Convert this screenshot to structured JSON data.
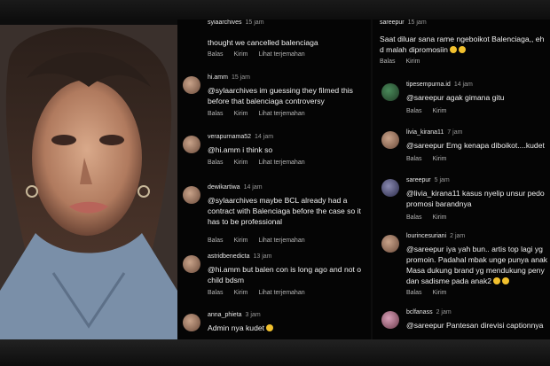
{
  "photo": {
    "label": ""
  },
  "actions": {
    "reply": "Balas",
    "send": "Kirim",
    "translate": "Lihat terjemahan"
  },
  "mid": {
    "top_user": "syiaarchives",
    "top_time": "15 jam",
    "top_text": "thought we cancelled balenciaga",
    "comments": [
      {
        "user": "hi.amm",
        "time": "15 jam",
        "text": "@sylaarchives im guessing they filmed this before that balenciaga controversy"
      },
      {
        "user": "verapurnama52",
        "time": "14 jam",
        "text": "@hi.amm i think so"
      },
      {
        "user": "dewikartiwa",
        "time": "14 jam",
        "text": "@sylaarchives maybe BCL already had a contract with Balenciaga before the case so it has to be professional"
      },
      {
        "user": "astridbenedicta",
        "time": "13 jam",
        "text": "@hi.amm but balen con is long ago and not o child bdsm"
      },
      {
        "user": "anna_phieta",
        "time": "3 jam",
        "text": "Admin nya kudet"
      }
    ]
  },
  "right": {
    "top_user": "sareepur",
    "top_time": "15 jam",
    "top_text": "Saat diluar sana rame ngeboikot Balenciaga,, eh d malah dipromosiin",
    "comments": [
      {
        "user": "tipesempurna.id",
        "time": "14 jam",
        "text": "@sareepur agak gimana gitu"
      },
      {
        "user": "livia_kirana11",
        "time": "7 jam",
        "text": "@sareepur Emg kenapa diboikot....kudet"
      },
      {
        "user": "sareepur",
        "time": "5 jam",
        "text": "@livia_kirana11 kasus nyelip unsur pedo promosi barandnya"
      },
      {
        "user": "lourincesuriani",
        "time": "2 jam",
        "text": "@sareepur iya yah bun.. artis top lagi yg promoin. Padahal mbak unge punya anak Masa dukung brand yg mendukung peny dan sadisme pada anak2"
      },
      {
        "user": "bclfanass",
        "time": "2 jam",
        "text": "@sareepur Pantesan direvisi captionnya"
      }
    ]
  }
}
